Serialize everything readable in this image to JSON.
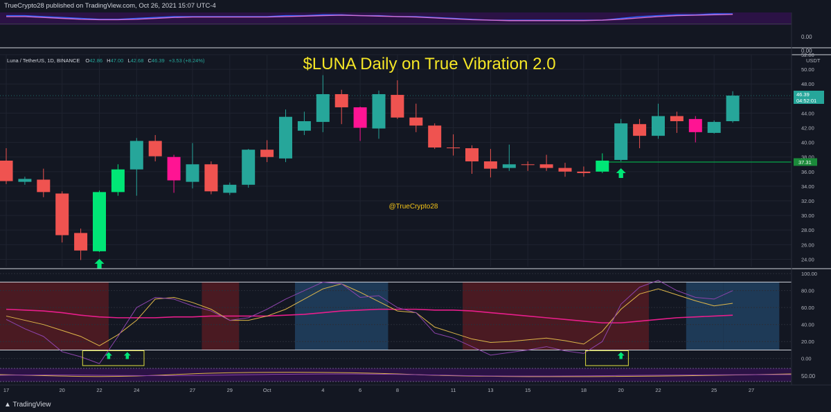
{
  "header": {
    "published_text": "TrueCrypto28 published on TradingView.com, Oct 26, 2021 15:07 UTC-4"
  },
  "symbol_info": {
    "name": "Luna / TetherUS, 1D, BINANCE",
    "o_label": "O",
    "o": "42.86",
    "h_label": "H",
    "h": "47.00",
    "l_label": "L",
    "l": "42.68",
    "c_label": "C",
    "c": "46.39",
    "change": "+3.53 (+8.24%)"
  },
  "title": "$LUNA Daily on True Vibration 2.0",
  "watermark": "@TrueCrypto28",
  "currency_label": "USDT",
  "price_tags": {
    "last_price": "46.39",
    "countdown": "04:52:01",
    "level": "37.31"
  },
  "top_pane_axis": [
    "0.00",
    "0.00"
  ],
  "bottom_pane_axis": [
    "50.00"
  ],
  "footer": {
    "logo_text": "TradingView"
  },
  "colors": {
    "background": "#131722",
    "bull": "#26a69a",
    "bear": "#ef5350",
    "signal_green": "#00e676",
    "signal_magenta": "#ff1493",
    "title": "#f5e626",
    "watermark": "#f5c518",
    "level_line": "#00c853",
    "bear_zone": "#4a1a22",
    "bull_zone": "#1e3a57"
  },
  "chart_data": {
    "type": "candlestick",
    "title": "$LUNA Daily on True Vibration 2.0",
    "y_unit": "USDT",
    "ylim": [
      23,
      52
    ],
    "price_ticks": [
      24,
      26,
      28,
      30,
      32,
      34,
      36,
      38,
      40,
      42,
      44,
      46,
      48,
      50,
      52
    ],
    "x_tick_labels": [
      {
        "label": "17",
        "index": 0
      },
      {
        "label": "20",
        "index": 3
      },
      {
        "label": "22",
        "index": 5
      },
      {
        "label": "24",
        "index": 7
      },
      {
        "label": "27",
        "index": 10
      },
      {
        "label": "29",
        "index": 12
      },
      {
        "label": "Oct",
        "index": 14
      },
      {
        "label": "4",
        "index": 17
      },
      {
        "label": "6",
        "index": 19
      },
      {
        "label": "8",
        "index": 21
      },
      {
        "label": "11",
        "index": 24
      },
      {
        "label": "13",
        "index": 26
      },
      {
        "label": "15",
        "index": 28
      },
      {
        "label": "18",
        "index": 31
      },
      {
        "label": "20",
        "index": 33
      },
      {
        "label": "22",
        "index": 35
      },
      {
        "label": "25",
        "index": 38
      },
      {
        "label": "27",
        "index": 40
      }
    ],
    "candles": [
      {
        "o": 37.5,
        "h": 39.2,
        "l": 34.3,
        "c": 34.7,
        "color": "bear"
      },
      {
        "o": 34.6,
        "h": 35.3,
        "l": 34.2,
        "c": 35.0,
        "color": "bull"
      },
      {
        "o": 34.9,
        "h": 36.4,
        "l": 32.5,
        "c": 33.2,
        "color": "bear"
      },
      {
        "o": 33.0,
        "h": 33.3,
        "l": 26.3,
        "c": 27.3,
        "color": "bear"
      },
      {
        "o": 27.6,
        "h": 28.2,
        "l": 23.9,
        "c": 25.2,
        "color": "bear"
      },
      {
        "o": 25.1,
        "h": 33.4,
        "l": 25.0,
        "c": 33.2,
        "color": "signal"
      },
      {
        "o": 33.2,
        "h": 37.0,
        "l": 32.7,
        "c": 36.3,
        "color": "signal"
      },
      {
        "o": 36.3,
        "h": 40.6,
        "l": 32.7,
        "c": 40.2,
        "color": "bull"
      },
      {
        "o": 40.2,
        "h": 41.0,
        "l": 37.4,
        "c": 38.1,
        "color": "bear"
      },
      {
        "o": 38.0,
        "h": 38.3,
        "l": 33.1,
        "c": 34.8,
        "color": "magenta"
      },
      {
        "o": 34.6,
        "h": 39.9,
        "l": 33.7,
        "c": 37.0,
        "color": "bull"
      },
      {
        "o": 37.0,
        "h": 37.4,
        "l": 32.9,
        "c": 33.3,
        "color": "bear"
      },
      {
        "o": 33.1,
        "h": 34.5,
        "l": 32.8,
        "c": 34.2,
        "color": "bull"
      },
      {
        "o": 34.2,
        "h": 39.1,
        "l": 33.8,
        "c": 39.0,
        "color": "bull"
      },
      {
        "o": 39.0,
        "h": 40.3,
        "l": 37.3,
        "c": 38.0,
        "color": "bear"
      },
      {
        "o": 37.8,
        "h": 44.5,
        "l": 37.3,
        "c": 43.5,
        "color": "bull"
      },
      {
        "o": 41.6,
        "h": 44.2,
        "l": 41.0,
        "c": 42.9,
        "color": "bull"
      },
      {
        "o": 42.8,
        "h": 49.2,
        "l": 41.4,
        "c": 46.6,
        "color": "bull"
      },
      {
        "o": 46.6,
        "h": 47.2,
        "l": 42.5,
        "c": 44.8,
        "color": "bear"
      },
      {
        "o": 44.8,
        "h": 44.9,
        "l": 40.2,
        "c": 42.0,
        "color": "magenta"
      },
      {
        "o": 41.9,
        "h": 47.1,
        "l": 40.5,
        "c": 46.6,
        "color": "bull"
      },
      {
        "o": 46.5,
        "h": 48.5,
        "l": 43.2,
        "c": 43.4,
        "color": "bear"
      },
      {
        "o": 43.4,
        "h": 45.3,
        "l": 41.4,
        "c": 42.3,
        "color": "bear"
      },
      {
        "o": 42.3,
        "h": 42.6,
        "l": 39.1,
        "c": 39.3,
        "color": "bear"
      },
      {
        "o": 39.3,
        "h": 41.1,
        "l": 38.2,
        "c": 39.2,
        "color": "bear"
      },
      {
        "o": 39.2,
        "h": 39.6,
        "l": 35.7,
        "c": 37.4,
        "color": "bear"
      },
      {
        "o": 37.4,
        "h": 39.1,
        "l": 35.2,
        "c": 36.4,
        "color": "bear"
      },
      {
        "o": 36.5,
        "h": 39.7,
        "l": 36.1,
        "c": 37.0,
        "color": "bull"
      },
      {
        "o": 37.0,
        "h": 37.4,
        "l": 36.1,
        "c": 36.9,
        "color": "bear"
      },
      {
        "o": 37.0,
        "h": 38.3,
        "l": 36.1,
        "c": 36.5,
        "color": "bear"
      },
      {
        "o": 36.5,
        "h": 37.2,
        "l": 35.3,
        "c": 36.0,
        "color": "bear"
      },
      {
        "o": 36.0,
        "h": 36.7,
        "l": 35.3,
        "c": 35.8,
        "color": "bear"
      },
      {
        "o": 36.0,
        "h": 38.5,
        "l": 35.8,
        "c": 37.5,
        "color": "signal"
      },
      {
        "o": 37.6,
        "h": 43.2,
        "l": 37.4,
        "c": 42.6,
        "color": "bull"
      },
      {
        "o": 42.5,
        "h": 43.2,
        "l": 39.2,
        "c": 40.9,
        "color": "bear"
      },
      {
        "o": 40.9,
        "h": 45.3,
        "l": 40.5,
        "c": 43.6,
        "color": "bull"
      },
      {
        "o": 43.6,
        "h": 44.2,
        "l": 41.3,
        "c": 42.9,
        "color": "bear"
      },
      {
        "o": 43.2,
        "h": 43.6,
        "l": 40.0,
        "c": 41.4,
        "color": "magenta"
      },
      {
        "o": 41.3,
        "h": 43.0,
        "l": 41.2,
        "c": 42.8,
        "color": "bull"
      },
      {
        "o": 42.9,
        "h": 47.0,
        "l": 42.7,
        "c": 46.4,
        "color": "bull"
      }
    ],
    "level_line": {
      "value": 37.31,
      "from_index": 32
    },
    "buy_signal_arrows": [
      5,
      33
    ],
    "oscillator": {
      "ylim": [
        -10,
        105
      ],
      "ticks": [
        0,
        20,
        40,
        60,
        80,
        100
      ],
      "overbought": 90,
      "oversold": 10,
      "zones": [
        {
          "from": 0,
          "to": 5,
          "kind": "bear"
        },
        {
          "from": 11,
          "to": 12,
          "kind": "bear"
        },
        {
          "from": 16,
          "to": 20,
          "kind": "bull"
        },
        {
          "from": 25,
          "to": 34,
          "kind": "bear"
        },
        {
          "from": 37,
          "to": 38,
          "kind": "bull"
        },
        {
          "from": 39,
          "to": 41,
          "kind": "bull"
        }
      ],
      "series": [
        {
          "kind": "slow",
          "color": "#e91e8c",
          "values": [
            58,
            57,
            56,
            54,
            51,
            49,
            48,
            48,
            48,
            49,
            49,
            50,
            50,
            50,
            50,
            51,
            52,
            54,
            56,
            57,
            58,
            58,
            58,
            57,
            57,
            56,
            54,
            52,
            50,
            48,
            46,
            44,
            42,
            42,
            44,
            46,
            48,
            49,
            50,
            51
          ]
        },
        {
          "kind": "signal",
          "color": "#e0b84a",
          "values": [
            50,
            45,
            40,
            33,
            26,
            15,
            28,
            45,
            70,
            72,
            66,
            58,
            45,
            45,
            50,
            58,
            70,
            82,
            88,
            78,
            67,
            56,
            54,
            37,
            30,
            23,
            19,
            20,
            22,
            24,
            21,
            17,
            32,
            58,
            76,
            82,
            75,
            68,
            62,
            65
          ]
        },
        {
          "kind": "fast",
          "color": "#8e44ad",
          "values": [
            46,
            35,
            26,
            8,
            2,
            -6,
            26,
            60,
            72,
            70,
            62,
            56,
            45,
            48,
            58,
            70,
            80,
            90,
            88,
            72,
            74,
            60,
            54,
            30,
            24,
            14,
            4,
            7,
            10,
            14,
            9,
            6,
            20,
            64,
            84,
            92,
            80,
            72,
            70,
            80
          ]
        }
      ],
      "signal_boxes": [
        {
          "from": 5,
          "to": 7
        },
        {
          "from": 32,
          "to": 33
        }
      ],
      "signal_arrows": [
        5.5,
        6.5,
        33
      ]
    },
    "top_pane": {
      "series": [
        {
          "color": "#2962ff",
          "values": [
            0.8,
            0.8,
            0.7,
            0.6,
            0.5,
            0.4,
            0.4,
            0.5,
            0.6,
            0.7,
            0.7,
            0.7,
            0.7,
            0.7,
            0.7,
            0.8,
            0.8,
            0.9,
            0.9,
            0.8,
            0.8,
            0.7,
            0.7,
            0.6,
            0.5,
            0.4,
            0.3,
            0.3,
            0.3,
            0.3,
            0.3,
            0.3,
            0.3,
            0.5,
            0.7,
            0.8,
            0.9,
            0.9,
            1.0,
            1.0
          ]
        },
        {
          "color": "#d36fd0",
          "values": [
            0.7,
            0.7,
            0.6,
            0.5,
            0.4,
            0.35,
            0.35,
            0.4,
            0.5,
            0.6,
            0.65,
            0.65,
            0.65,
            0.65,
            0.65,
            0.7,
            0.75,
            0.8,
            0.85,
            0.8,
            0.75,
            0.7,
            0.65,
            0.55,
            0.45,
            0.35,
            0.3,
            0.25,
            0.25,
            0.25,
            0.25,
            0.25,
            0.3,
            0.4,
            0.55,
            0.7,
            0.8,
            0.85,
            0.9,
            0.95
          ]
        }
      ]
    }
  }
}
